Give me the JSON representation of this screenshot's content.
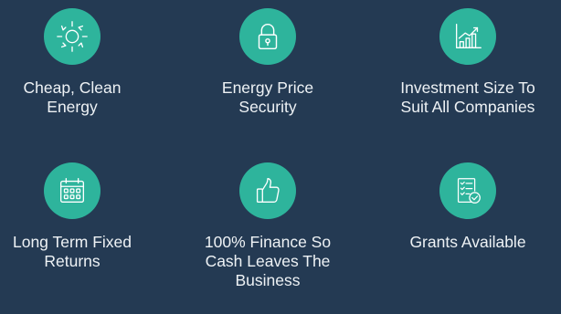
{
  "features": [
    {
      "icon": "sun-icon",
      "label": "Cheap, Clean\nEnergy"
    },
    {
      "icon": "padlock-icon",
      "label": "Energy Price\nSecurity"
    },
    {
      "icon": "growth-chart-icon",
      "label": "Investment Size To\nSuit All Companies"
    },
    {
      "icon": "calendar-icon",
      "label": "Long Term Fixed\nReturns"
    },
    {
      "icon": "thumbs-up-icon",
      "label": "100% Finance So\nCash Leaves The\nBusiness"
    },
    {
      "icon": "checklist-document-icon",
      "label": "Grants Available"
    }
  ],
  "colors": {
    "background": "#243a53",
    "icon_circle": "#2eb49c",
    "text": "#eef2f5"
  }
}
